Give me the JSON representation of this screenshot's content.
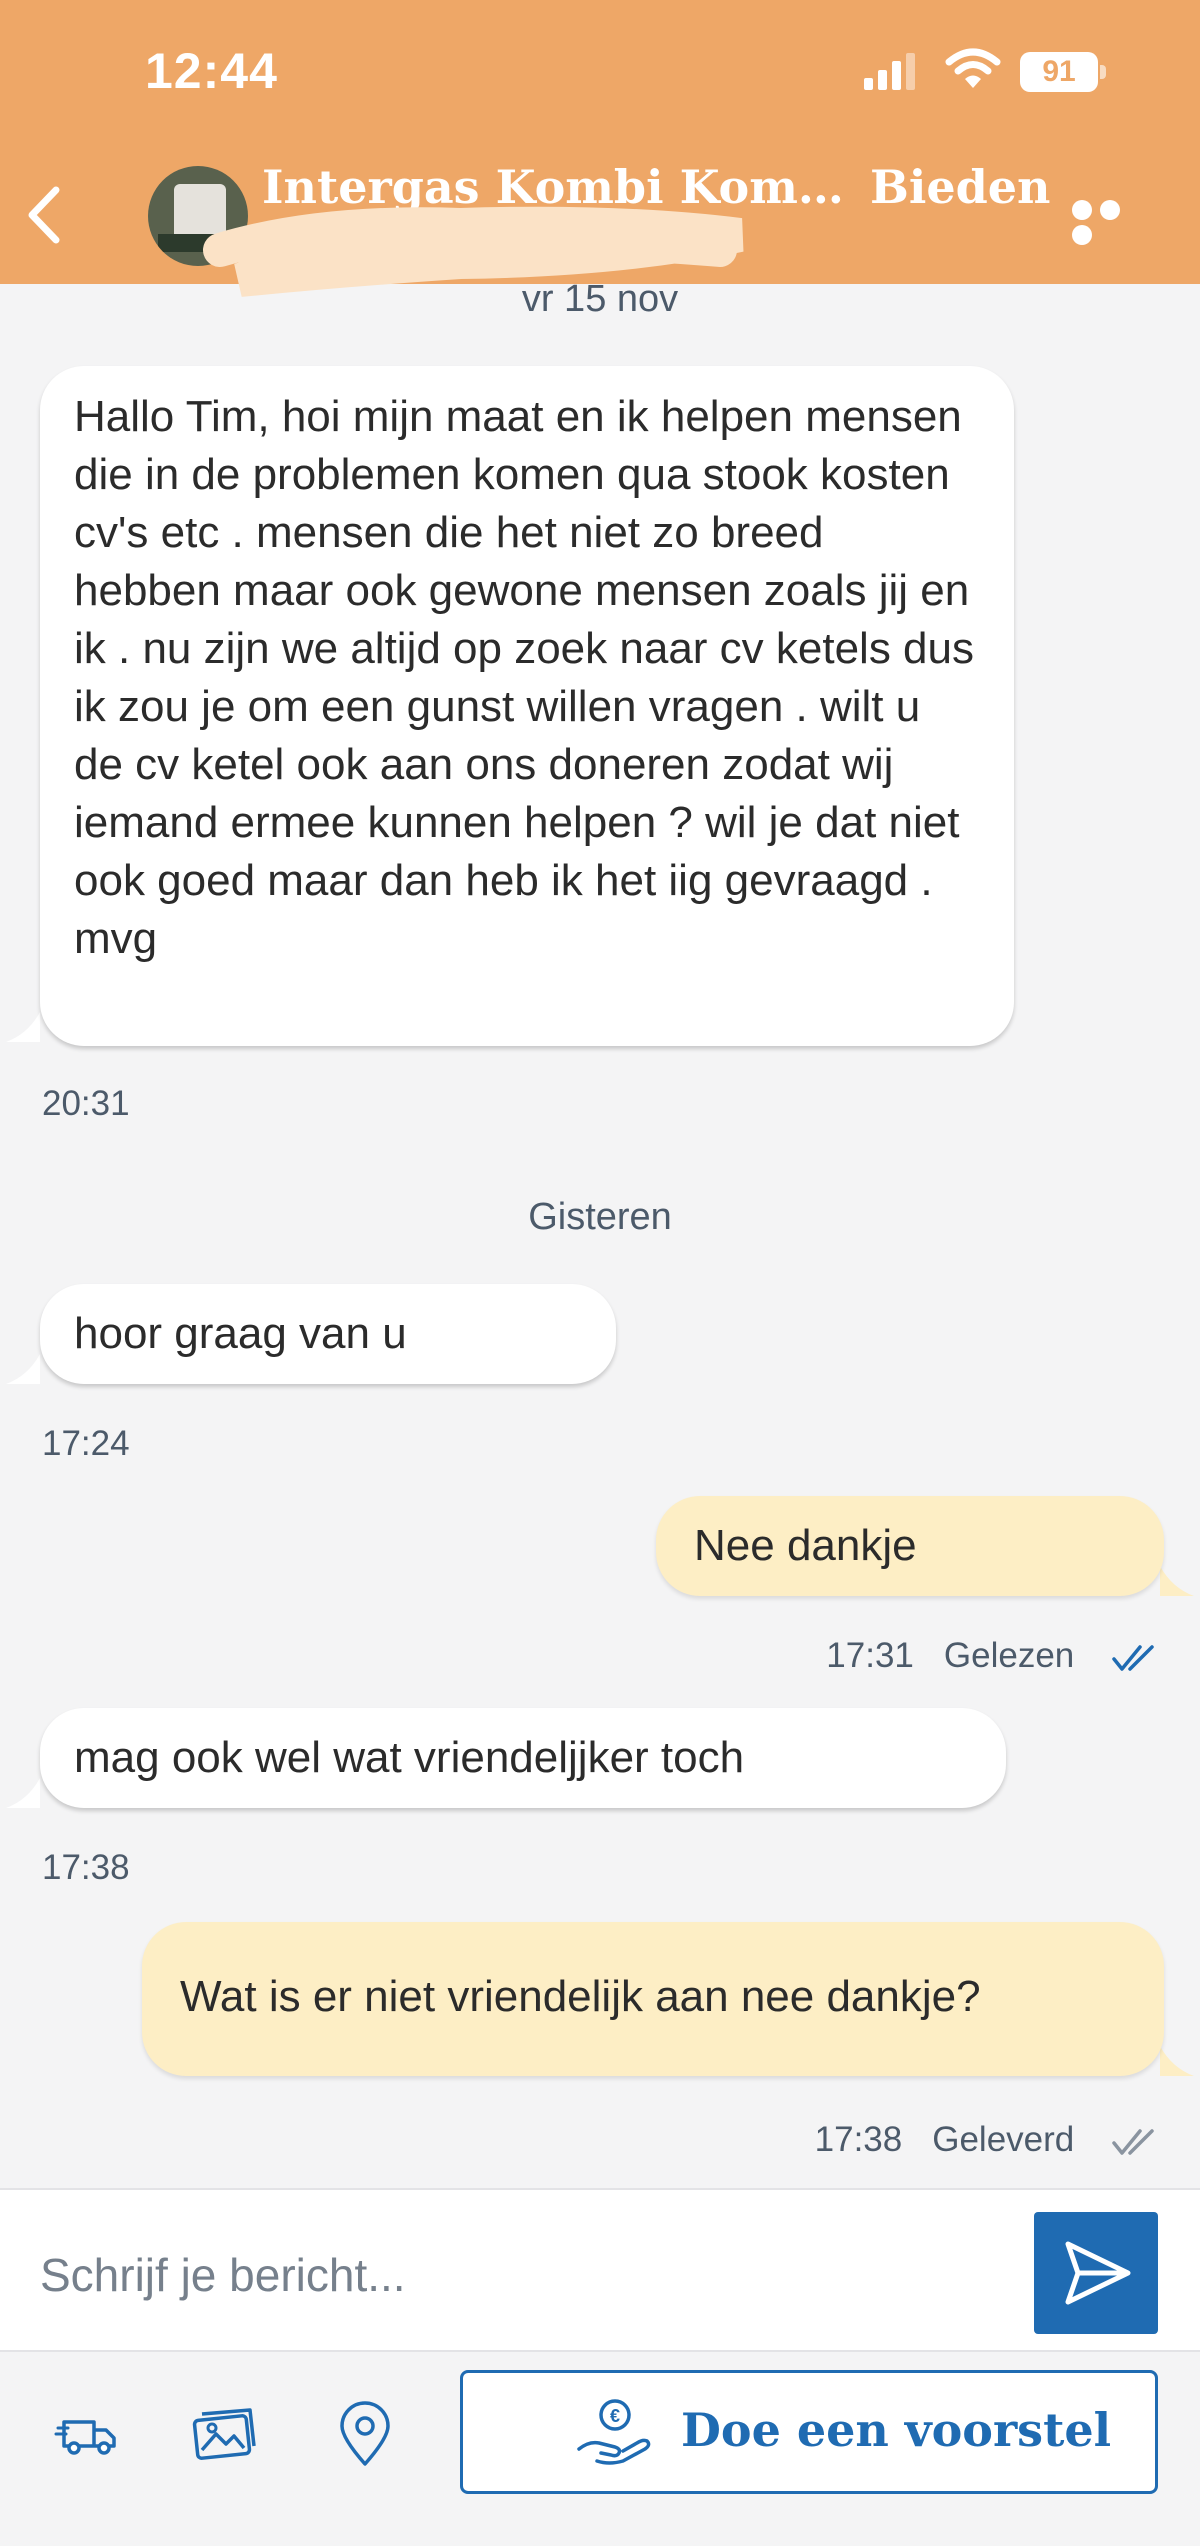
{
  "status_bar": {
    "time": "12:44",
    "battery": "91"
  },
  "header": {
    "title": "Intergas Kombi Kompakt...",
    "action": "Bieden"
  },
  "messages": {
    "date_1": "vr 15 nov",
    "m1_text": "Hallo Tim,  hoi mijn maat en ik helpen mensen die in de problemen komen qua stook kosten cv's etc . mensen die het niet zo breed hebben maar ook gewone mensen zoals jij en ik . nu zijn we altijd op zoek naar cv ketels dus ik zou je om een gunst willen vragen . wilt u de cv ketel ook aan ons doneren zodat wij iemand ermee kunnen helpen ? wil je dat niet ook goed maar dan heb ik het iig gevraagd . mvg",
    "m1_time": "20:31",
    "date_2": "Gisteren",
    "m2_text": "hoor graag van u",
    "m2_time": "17:24",
    "m3_text": "Nee dankje",
    "m3_time": "17:31",
    "m3_status": "Gelezen",
    "m4_text": "mag ook wel wat vriendeljjker toch",
    "m4_time": "17:38",
    "m5_text": "Wat is er niet vriendelijk aan nee dankje?",
    "m5_time": "17:38",
    "m5_status": "Geleverd"
  },
  "composer": {
    "placeholder": "Schrijf je bericht..."
  },
  "bottom_bar": {
    "offer_label": "Doe een voorstel"
  },
  "colors": {
    "header": "#eea767",
    "accent_blue": "#1f6bb2",
    "outgoing_bubble": "#fdeec5",
    "incoming_bubble": "#ffffff",
    "read_tick": "#1f6bb2",
    "delivered_tick": "#8a94a0"
  },
  "icons": [
    "back-chevron-icon",
    "more-dots-icon",
    "send-icon",
    "delivery-truck-icon",
    "gallery-icon",
    "location-pin-icon",
    "offer-hand-euro-icon",
    "double-check-icon"
  ]
}
